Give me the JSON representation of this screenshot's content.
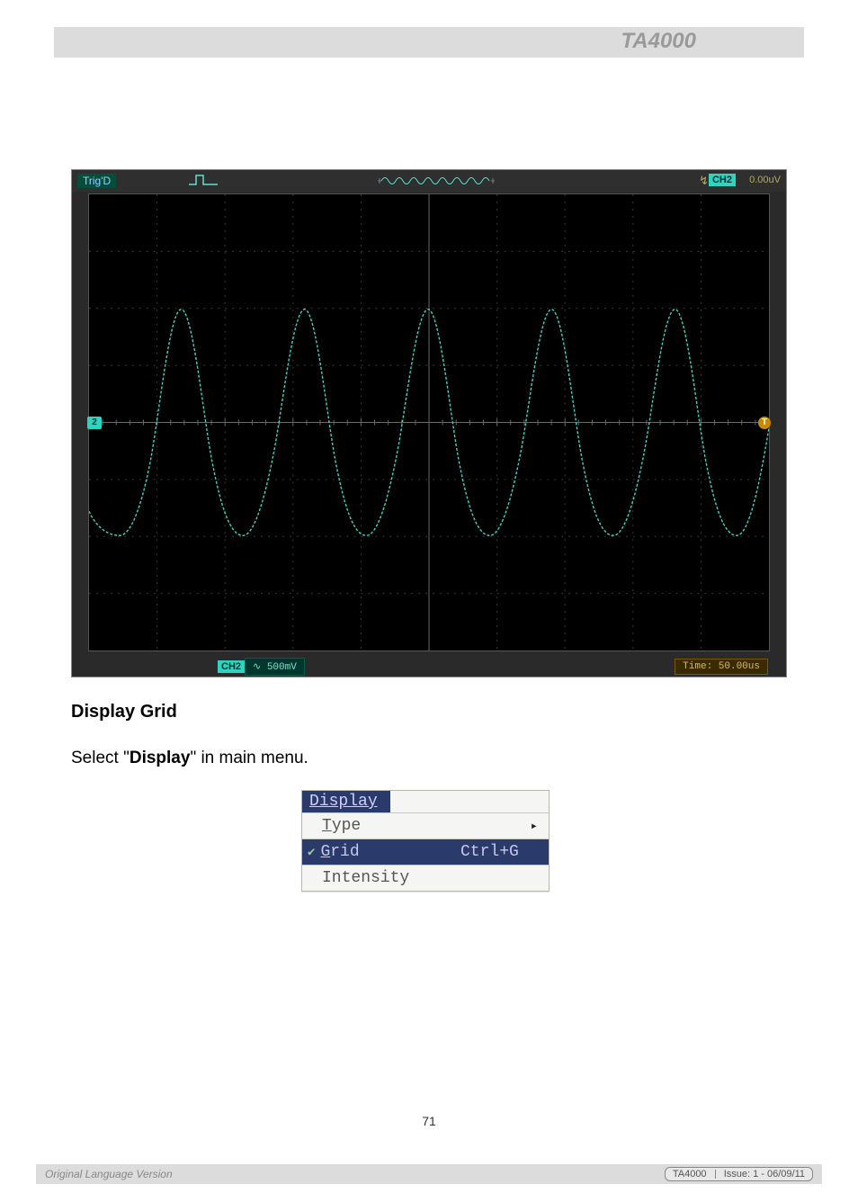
{
  "header": {
    "model": "TA4000"
  },
  "scope": {
    "top_left_status": "Trig'D",
    "ch_badge_top": "CH2",
    "top_right_value": "0.00uV",
    "ch2_bottom_badge": "CH2",
    "ch2_bottom_value": "∿ 500mV",
    "time_value": "Time: 50.00us",
    "ch_marker_left": "2",
    "trig_marker": "T",
    "t_marker_top": "T"
  },
  "section": {
    "heading": "Display Grid",
    "sentence_pre": "Select \"",
    "sentence_bold": "Display",
    "sentence_post": "\" in main menu."
  },
  "menu": {
    "title": "Display",
    "items": [
      {
        "label": "Type",
        "shortcut": "",
        "arrow": "▸",
        "checked": false,
        "selected": false,
        "underline_first": true
      },
      {
        "label": "Grid",
        "shortcut": "Ctrl+G",
        "arrow": "",
        "checked": true,
        "selected": true,
        "underline_first": true
      },
      {
        "label": "Intensity",
        "shortcut": "",
        "arrow": "",
        "checked": false,
        "selected": false,
        "underline_first": false
      }
    ]
  },
  "footer": {
    "page_number": "71",
    "left": "Original Language Version",
    "right_model": "TA4000",
    "right_issue": "Issue: 1 - 06/09/11"
  }
}
